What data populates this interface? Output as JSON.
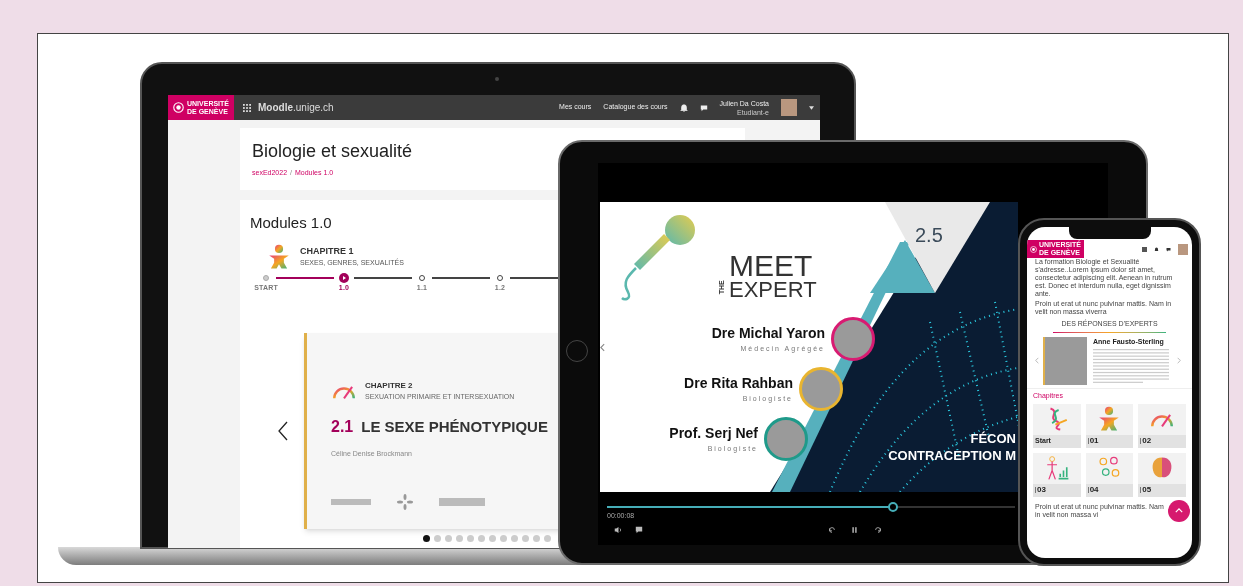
{
  "laptop": {
    "logo": [
      "UNIVERSITÉ",
      "DE GENÈVE"
    ],
    "site": "**Moodle**.unige.ch",
    "nav": [
      "Mes cours",
      "Catalogue des cours"
    ],
    "user": {
      "name": "Julien Da Costa",
      "role": "Etudiant-e"
    },
    "course_title": "Biologie et sexualité",
    "breadcrumb": [
      "sexEd2022",
      "Modules 1.0"
    ],
    "breadcrumb_separator": "/",
    "module_title": "Modules 1.0",
    "chapter": {
      "label": "CHAPITRE 1",
      "subtitle": "SEXES, GENRES, SEXUALITÉS"
    },
    "steps": [
      {
        "label": "START",
        "selected": false
      },
      {
        "label": "1.0",
        "selected": true
      },
      {
        "label": "1.1",
        "selected": false
      },
      {
        "label": "1.2",
        "selected": false
      }
    ],
    "slide": {
      "chapter": "CHAPITRE 2",
      "subtitle": "SEXUATION PRIMAIRE ET INTERSEXUATION",
      "number": "2.1",
      "title": "LE SEXE PHÉNOTYPIQUE",
      "author": "Céline Denise Brockmann"
    },
    "carousel_dots": [
      {
        "selected": true
      },
      {
        "selected": false
      },
      {
        "selected": false
      },
      {
        "selected": false
      },
      {
        "selected": false
      },
      {
        "selected": false
      },
      {
        "selected": false
      },
      {
        "selected": false
      },
      {
        "selected": false
      },
      {
        "selected": false
      },
      {
        "selected": false
      },
      {
        "selected": false
      }
    ]
  },
  "tablet": {
    "badge": "2.5",
    "logo": {
      "top": "MEET",
      "side": "THE",
      "bottom": "EXPERT"
    },
    "experts": [
      {
        "name": "Dre Michal Yaron",
        "role": "Médecin Agrégée",
        "color": "#d81b72"
      },
      {
        "name": "Dre Rita Rahban",
        "role": "Biologiste",
        "color": "#e9b530"
      },
      {
        "name": "Prof. Serj Nef",
        "role": "Biologiste",
        "color": "#1f9a8a"
      }
    ],
    "headline": [
      "FÉCON",
      "CONTRACEPTION M"
    ],
    "player": {
      "time": "00:00:08",
      "level": 0.7
    }
  },
  "phone": {
    "logo": [
      "UNIVERSITÉ",
      "DE GENÈVE"
    ],
    "intro": "La formation Biologie et Sexualité s'adresse..Lorem ipsum dolor sit amet, consectetur adipiscing elit. Aenean in rutrum est. Donec et interdum nulla, eget dignissim ante.",
    "paragraph": "Proin ut erat ut nunc pulvinar mattis. Nam in velit non massa viverra",
    "section_title": "DES RÉPONSES D'EXPERTS",
    "expert_name": "Anne Fausto-Sterling",
    "chapters_title": "Chapitres",
    "chapters": [
      {
        "label": "Start",
        "kind": "dna"
      },
      {
        "label": "01",
        "kind": "figure"
      },
      {
        "label": "02",
        "kind": "gauge"
      },
      {
        "label": "03",
        "kind": "body"
      },
      {
        "label": "04",
        "kind": "cells"
      },
      {
        "label": "05",
        "kind": "brain"
      }
    ],
    "footer": "Proin ut erat ut nunc pulvinar mattis. Nam in velit non massa vi"
  }
}
